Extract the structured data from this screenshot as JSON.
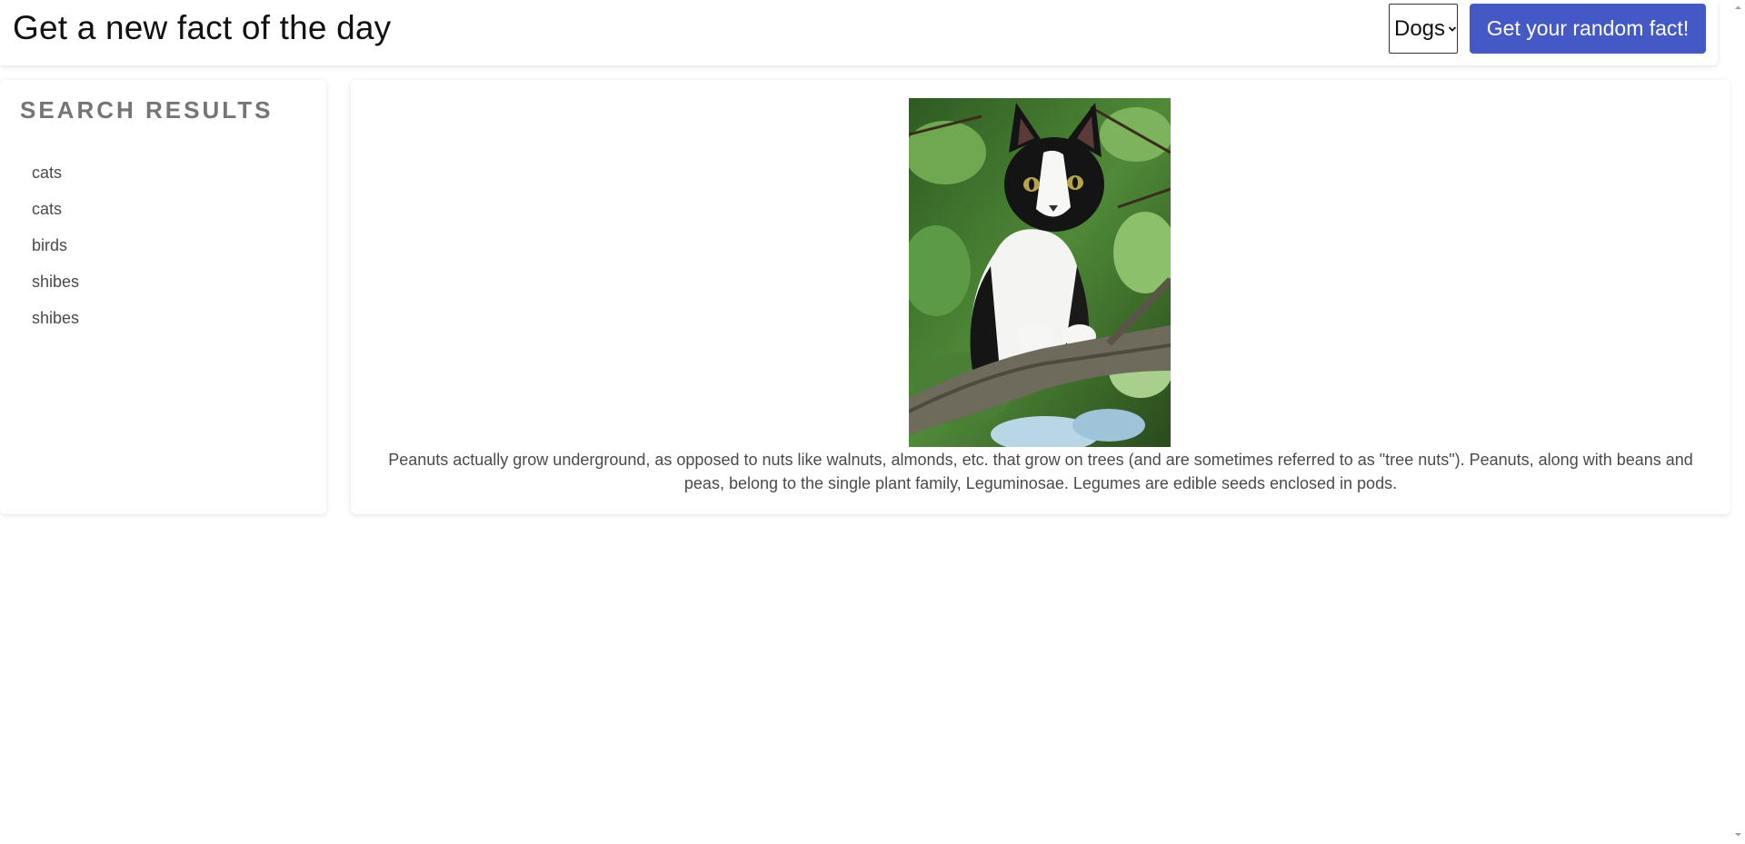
{
  "header": {
    "title": "Get a new fact of the day",
    "select_value": "Dogs",
    "button_label": "Get your random fact!"
  },
  "sidebar": {
    "title": "SEARCH RESULTS",
    "items": [
      {
        "label": "cats"
      },
      {
        "label": "cats"
      },
      {
        "label": "birds"
      },
      {
        "label": "shibes"
      },
      {
        "label": "shibes"
      }
    ]
  },
  "main": {
    "fact": "Peanuts actually grow underground, as opposed to nuts like walnuts, almonds, etc. that grow on trees (and are sometimes referred to as \"tree nuts\"). Peanuts, along with beans and peas, belong to the single plant family, Leguminosae. Legumes are edible seeds enclosed in pods."
  },
  "colors": {
    "accent": "#4559c6",
    "sidebar_title": "#757575",
    "body_text": "#4a4a4a"
  },
  "icons": {
    "select_arrow": "chevron-down-icon",
    "scroll_up": "scroll-up-arrow-icon",
    "scroll_down": "scroll-down-arrow-icon"
  }
}
